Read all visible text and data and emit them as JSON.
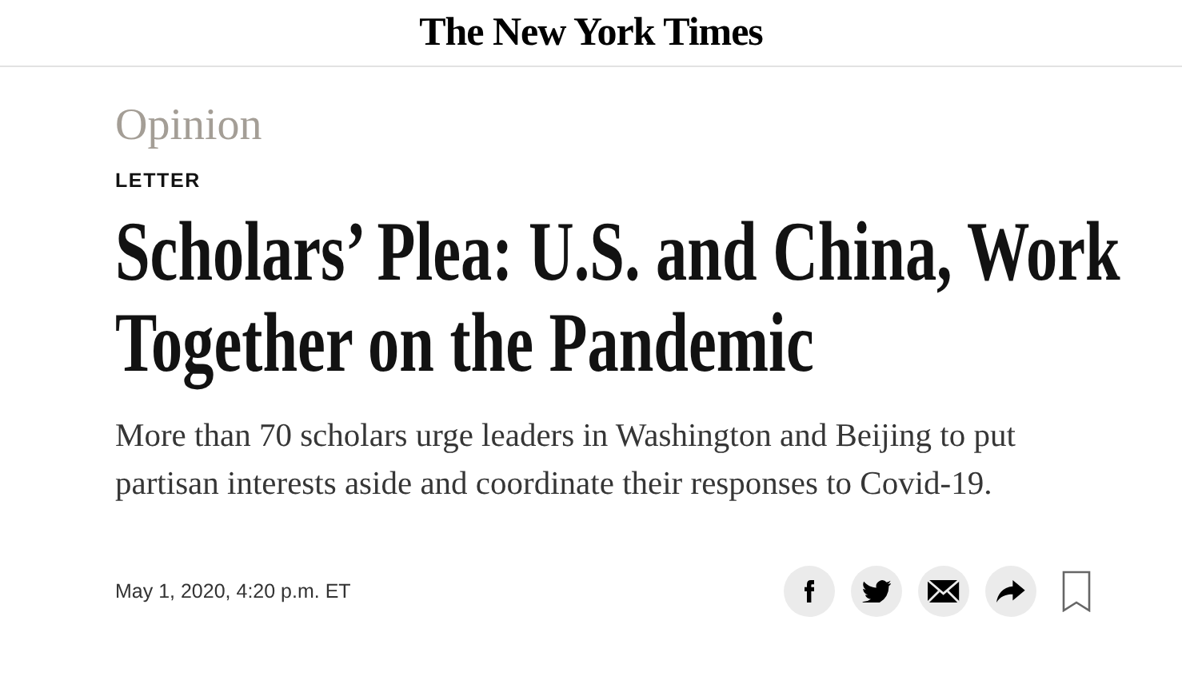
{
  "masthead": {
    "logo": "The New York Times"
  },
  "article": {
    "section": "Opinion",
    "kicker": "LETTER",
    "headline": "Scholars’ Plea: U.S. and China, Work Together on the Pandemic",
    "summary": "More than 70 scholars urge leaders in Washington and Beijing to put partisan interests aside and coordinate their responses to Covid-19.",
    "dateline": "May 1, 2020, 4:20 p.m. ET"
  },
  "share_tools": [
    {
      "kind": "facebook"
    },
    {
      "kind": "twitter"
    },
    {
      "kind": "email"
    },
    {
      "kind": "share"
    },
    {
      "kind": "bookmark"
    }
  ]
}
